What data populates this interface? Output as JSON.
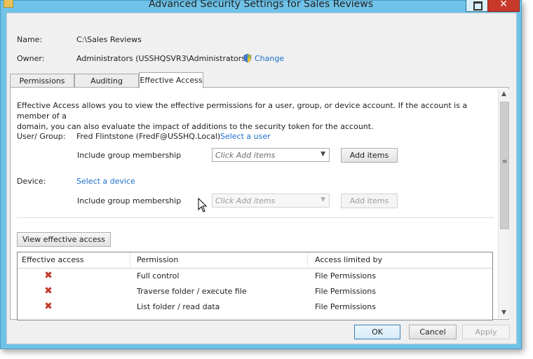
{
  "window": {
    "title": "Advanced Security Settings for Sales Reviews",
    "close_glyph": "✕"
  },
  "header": {
    "name_label": "Name:",
    "name_value": "C:\\Sales Reviews",
    "owner_label": "Owner:",
    "owner_value": "Administrators (USSHQSVR3\\Administrators)",
    "change_link": "Change"
  },
  "tabs": [
    {
      "label": "Permissions",
      "active": false
    },
    {
      "label": "Auditing",
      "active": false
    },
    {
      "label": "Effective Access",
      "active": true
    }
  ],
  "effective_access": {
    "description_line1": "Effective Access allows you to view the effective permissions for a user, group, or device account. If the account is a member of a",
    "description_line2": "domain, you can also evaluate the impact of additions to the security token for the account.",
    "user_group_label": "User/ Group:",
    "user_group_value": "Fred Flintstone (FredF@USSHQ.Local)",
    "select_user_link": "Select a user",
    "include_group_label": "Include group membership",
    "user_combo_placeholder": "Click Add items",
    "add_items_label": "Add items",
    "device_label": "Device:",
    "select_device_link": "Select a device",
    "device_include_group_label": "Include group membership",
    "device_combo_placeholder": "Click Add items",
    "device_add_items_label": "Add items",
    "view_effective_access_label": "View effective access"
  },
  "results_table": {
    "columns": [
      "Effective access",
      "Permission",
      "Access limited by"
    ],
    "rows": [
      {
        "effective_icon": "✖",
        "permission": "Full control",
        "limited_by": "File Permissions"
      },
      {
        "effective_icon": "✖",
        "permission": "Traverse folder / execute file",
        "limited_by": "File Permissions"
      },
      {
        "effective_icon": "✖",
        "permission": "List folder / read data",
        "limited_by": "File Permissions"
      }
    ]
  },
  "footer": {
    "ok_label": "OK",
    "cancel_label": "Cancel",
    "apply_label": "Apply"
  },
  "icons": {
    "app": "folder-icon",
    "shield": "shield-icon",
    "deny": "deny-x-icon",
    "cursor": "mouse-pointer-icon"
  },
  "colors": {
    "window_accent": "#6fc3e8",
    "link": "#1a6fcc",
    "deny_red": "#c0392b",
    "close_button": "#c7392b"
  }
}
